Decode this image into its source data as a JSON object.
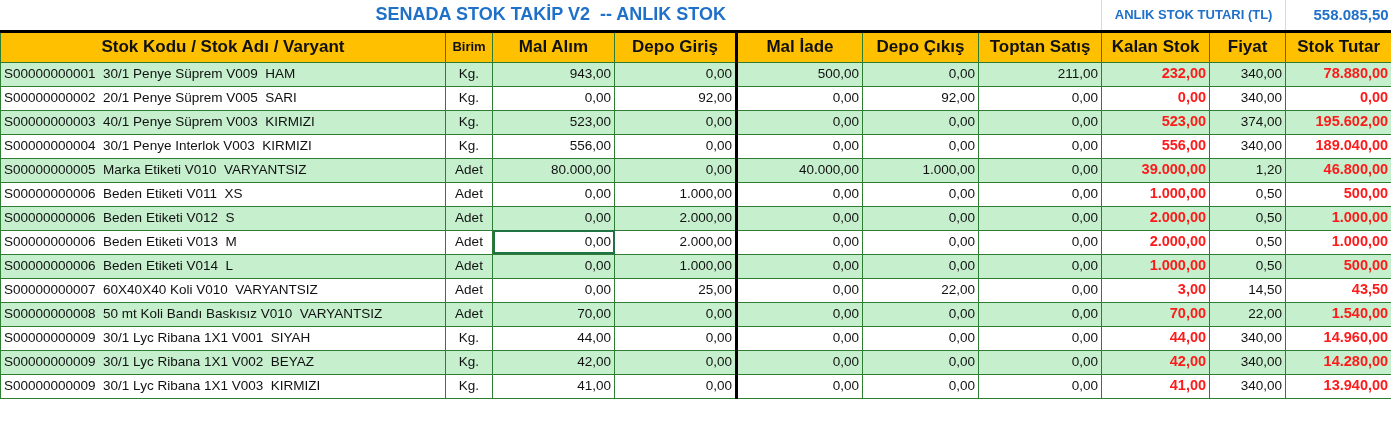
{
  "title": "SENADA STOK TAKİP V2  -- ANLIK STOK",
  "total": {
    "label": "ANLIK STOK TUTARI (TL)",
    "value": "558.085,50"
  },
  "columns": [
    {
      "label": "Stok Kodu / Stok Adı / Varyant",
      "kind": "text",
      "divider_after": false
    },
    {
      "label": "Birim",
      "kind": "unit",
      "divider_after": false
    },
    {
      "label": "Mal Alım",
      "kind": "number",
      "divider_after": false
    },
    {
      "label": "Depo Giriş",
      "kind": "number",
      "divider_after": true
    },
    {
      "label": "Mal İade",
      "kind": "number",
      "divider_after": false
    },
    {
      "label": "Depo Çıkış",
      "kind": "number",
      "divider_after": false
    },
    {
      "label": "Toptan Satış",
      "kind": "number",
      "divider_after": false
    },
    {
      "label": "Kalan Stok",
      "kind": "alert",
      "divider_after": false
    },
    {
      "label": "Fiyat",
      "kind": "number",
      "divider_after": false
    },
    {
      "label": "Stok Tutar",
      "kind": "alert",
      "divider_after": false
    }
  ],
  "rows": [
    {
      "cells": [
        {
          "text": "S00000000001  30/1 Penye Süprem V009  HAM",
          "selected": false
        },
        {
          "text": "Kg.",
          "selected": false
        },
        {
          "text": "943,00",
          "selected": false
        },
        {
          "text": "0,00",
          "selected": false
        },
        {
          "text": "500,00",
          "selected": false
        },
        {
          "text": "0,00",
          "selected": false
        },
        {
          "text": "211,00",
          "selected": false
        },
        {
          "text": "232,00",
          "selected": false
        },
        {
          "text": "340,00",
          "selected": false
        },
        {
          "text": "78.880,00",
          "selected": false
        }
      ]
    },
    {
      "cells": [
        {
          "text": "S00000000002  20/1 Penye Süprem V005  SARI",
          "selected": false
        },
        {
          "text": "Kg.",
          "selected": false
        },
        {
          "text": "0,00",
          "selected": false
        },
        {
          "text": "92,00",
          "selected": false
        },
        {
          "text": "0,00",
          "selected": false
        },
        {
          "text": "92,00",
          "selected": false
        },
        {
          "text": "0,00",
          "selected": false
        },
        {
          "text": "0,00",
          "selected": false
        },
        {
          "text": "340,00",
          "selected": false
        },
        {
          "text": "0,00",
          "selected": false
        }
      ]
    },
    {
      "cells": [
        {
          "text": "S00000000003  40/1 Penye Süprem V003  KIRMIZI",
          "selected": false
        },
        {
          "text": "Kg.",
          "selected": false
        },
        {
          "text": "523,00",
          "selected": false
        },
        {
          "text": "0,00",
          "selected": false
        },
        {
          "text": "0,00",
          "selected": false
        },
        {
          "text": "0,00",
          "selected": false
        },
        {
          "text": "0,00",
          "selected": false
        },
        {
          "text": "523,00",
          "selected": false
        },
        {
          "text": "374,00",
          "selected": false
        },
        {
          "text": "195.602,00",
          "selected": false
        }
      ]
    },
    {
      "cells": [
        {
          "text": "S00000000004  30/1 Penye Interlok V003  KIRMIZI",
          "selected": false
        },
        {
          "text": "Kg.",
          "selected": false
        },
        {
          "text": "556,00",
          "selected": false
        },
        {
          "text": "0,00",
          "selected": false
        },
        {
          "text": "0,00",
          "selected": false
        },
        {
          "text": "0,00",
          "selected": false
        },
        {
          "text": "0,00",
          "selected": false
        },
        {
          "text": "556,00",
          "selected": false
        },
        {
          "text": "340,00",
          "selected": false
        },
        {
          "text": "189.040,00",
          "selected": false
        }
      ]
    },
    {
      "cells": [
        {
          "text": "S00000000005  Marka Etiketi V010  VARYANTSIZ",
          "selected": false
        },
        {
          "text": "Adet",
          "selected": false
        },
        {
          "text": "80.000,00",
          "selected": false
        },
        {
          "text": "0,00",
          "selected": false
        },
        {
          "text": "40.000,00",
          "selected": false
        },
        {
          "text": "1.000,00",
          "selected": false
        },
        {
          "text": "0,00",
          "selected": false
        },
        {
          "text": "39.000,00",
          "selected": false
        },
        {
          "text": "1,20",
          "selected": false
        },
        {
          "text": "46.800,00",
          "selected": false
        }
      ]
    },
    {
      "cells": [
        {
          "text": "S00000000006  Beden Etiketi V011  XS",
          "selected": false
        },
        {
          "text": "Adet",
          "selected": false
        },
        {
          "text": "0,00",
          "selected": false
        },
        {
          "text": "1.000,00",
          "selected": false
        },
        {
          "text": "0,00",
          "selected": false
        },
        {
          "text": "0,00",
          "selected": false
        },
        {
          "text": "0,00",
          "selected": false
        },
        {
          "text": "1.000,00",
          "selected": false
        },
        {
          "text": "0,50",
          "selected": false
        },
        {
          "text": "500,00",
          "selected": false
        }
      ]
    },
    {
      "cells": [
        {
          "text": "S00000000006  Beden Etiketi V012  S",
          "selected": false
        },
        {
          "text": "Adet",
          "selected": false
        },
        {
          "text": "0,00",
          "selected": false
        },
        {
          "text": "2.000,00",
          "selected": false
        },
        {
          "text": "0,00",
          "selected": false
        },
        {
          "text": "0,00",
          "selected": false
        },
        {
          "text": "0,00",
          "selected": false
        },
        {
          "text": "2.000,00",
          "selected": false
        },
        {
          "text": "0,50",
          "selected": false
        },
        {
          "text": "1.000,00",
          "selected": false
        }
      ]
    },
    {
      "cells": [
        {
          "text": "S00000000006  Beden Etiketi V013  M",
          "selected": false
        },
        {
          "text": "Adet",
          "selected": false
        },
        {
          "text": "0,00",
          "selected": true
        },
        {
          "text": "2.000,00",
          "selected": false
        },
        {
          "text": "0,00",
          "selected": false
        },
        {
          "text": "0,00",
          "selected": false
        },
        {
          "text": "0,00",
          "selected": false
        },
        {
          "text": "2.000,00",
          "selected": false
        },
        {
          "text": "0,50",
          "selected": false
        },
        {
          "text": "1.000,00",
          "selected": false
        }
      ]
    },
    {
      "cells": [
        {
          "text": "S00000000006  Beden Etiketi V014  L",
          "selected": false
        },
        {
          "text": "Adet",
          "selected": false
        },
        {
          "text": "0,00",
          "selected": false
        },
        {
          "text": "1.000,00",
          "selected": false
        },
        {
          "text": "0,00",
          "selected": false
        },
        {
          "text": "0,00",
          "selected": false
        },
        {
          "text": "0,00",
          "selected": false
        },
        {
          "text": "1.000,00",
          "selected": false
        },
        {
          "text": "0,50",
          "selected": false
        },
        {
          "text": "500,00",
          "selected": false
        }
      ]
    },
    {
      "cells": [
        {
          "text": "S00000000007  60X40X40 Koli V010  VARYANTSIZ",
          "selected": false
        },
        {
          "text": "Adet",
          "selected": false
        },
        {
          "text": "0,00",
          "selected": false
        },
        {
          "text": "25,00",
          "selected": false
        },
        {
          "text": "0,00",
          "selected": false
        },
        {
          "text": "22,00",
          "selected": false
        },
        {
          "text": "0,00",
          "selected": false
        },
        {
          "text": "3,00",
          "selected": false
        },
        {
          "text": "14,50",
          "selected": false
        },
        {
          "text": "43,50",
          "selected": false
        }
      ]
    },
    {
      "cells": [
        {
          "text": "S00000000008  50 mt Koli Bandı Baskısız V010  VARYANTSIZ",
          "selected": false
        },
        {
          "text": "Adet",
          "selected": false
        },
        {
          "text": "70,00",
          "selected": false
        },
        {
          "text": "0,00",
          "selected": false
        },
        {
          "text": "0,00",
          "selected": false
        },
        {
          "text": "0,00",
          "selected": false
        },
        {
          "text": "0,00",
          "selected": false
        },
        {
          "text": "70,00",
          "selected": false
        },
        {
          "text": "22,00",
          "selected": false
        },
        {
          "text": "1.540,00",
          "selected": false
        }
      ]
    },
    {
      "cells": [
        {
          "text": "S00000000009  30/1 Lyc Ribana 1X1 V001  SIYAH",
          "selected": false
        },
        {
          "text": "Kg.",
          "selected": false
        },
        {
          "text": "44,00",
          "selected": false
        },
        {
          "text": "0,00",
          "selected": false
        },
        {
          "text": "0,00",
          "selected": false
        },
        {
          "text": "0,00",
          "selected": false
        },
        {
          "text": "0,00",
          "selected": false
        },
        {
          "text": "44,00",
          "selected": false
        },
        {
          "text": "340,00",
          "selected": false
        },
        {
          "text": "14.960,00",
          "selected": false
        }
      ]
    },
    {
      "cells": [
        {
          "text": "S00000000009  30/1 Lyc Ribana 1X1 V002  BEYAZ",
          "selected": false
        },
        {
          "text": "Kg.",
          "selected": false
        },
        {
          "text": "42,00",
          "selected": false
        },
        {
          "text": "0,00",
          "selected": false
        },
        {
          "text": "0,00",
          "selected": false
        },
        {
          "text": "0,00",
          "selected": false
        },
        {
          "text": "0,00",
          "selected": false
        },
        {
          "text": "42,00",
          "selected": false
        },
        {
          "text": "340,00",
          "selected": false
        },
        {
          "text": "14.280,00",
          "selected": false
        }
      ]
    },
    {
      "cells": [
        {
          "text": "S00000000009  30/1 Lyc Ribana 1X1 V003  KIRMIZI",
          "selected": false
        },
        {
          "text": "Kg.",
          "selected": false
        },
        {
          "text": "41,00",
          "selected": false
        },
        {
          "text": "0,00",
          "selected": false
        },
        {
          "text": "0,00",
          "selected": false
        },
        {
          "text": "0,00",
          "selected": false
        },
        {
          "text": "0,00",
          "selected": false
        },
        {
          "text": "41,00",
          "selected": false
        },
        {
          "text": "340,00",
          "selected": false
        },
        {
          "text": "13.940,00",
          "selected": false
        }
      ]
    }
  ]
}
